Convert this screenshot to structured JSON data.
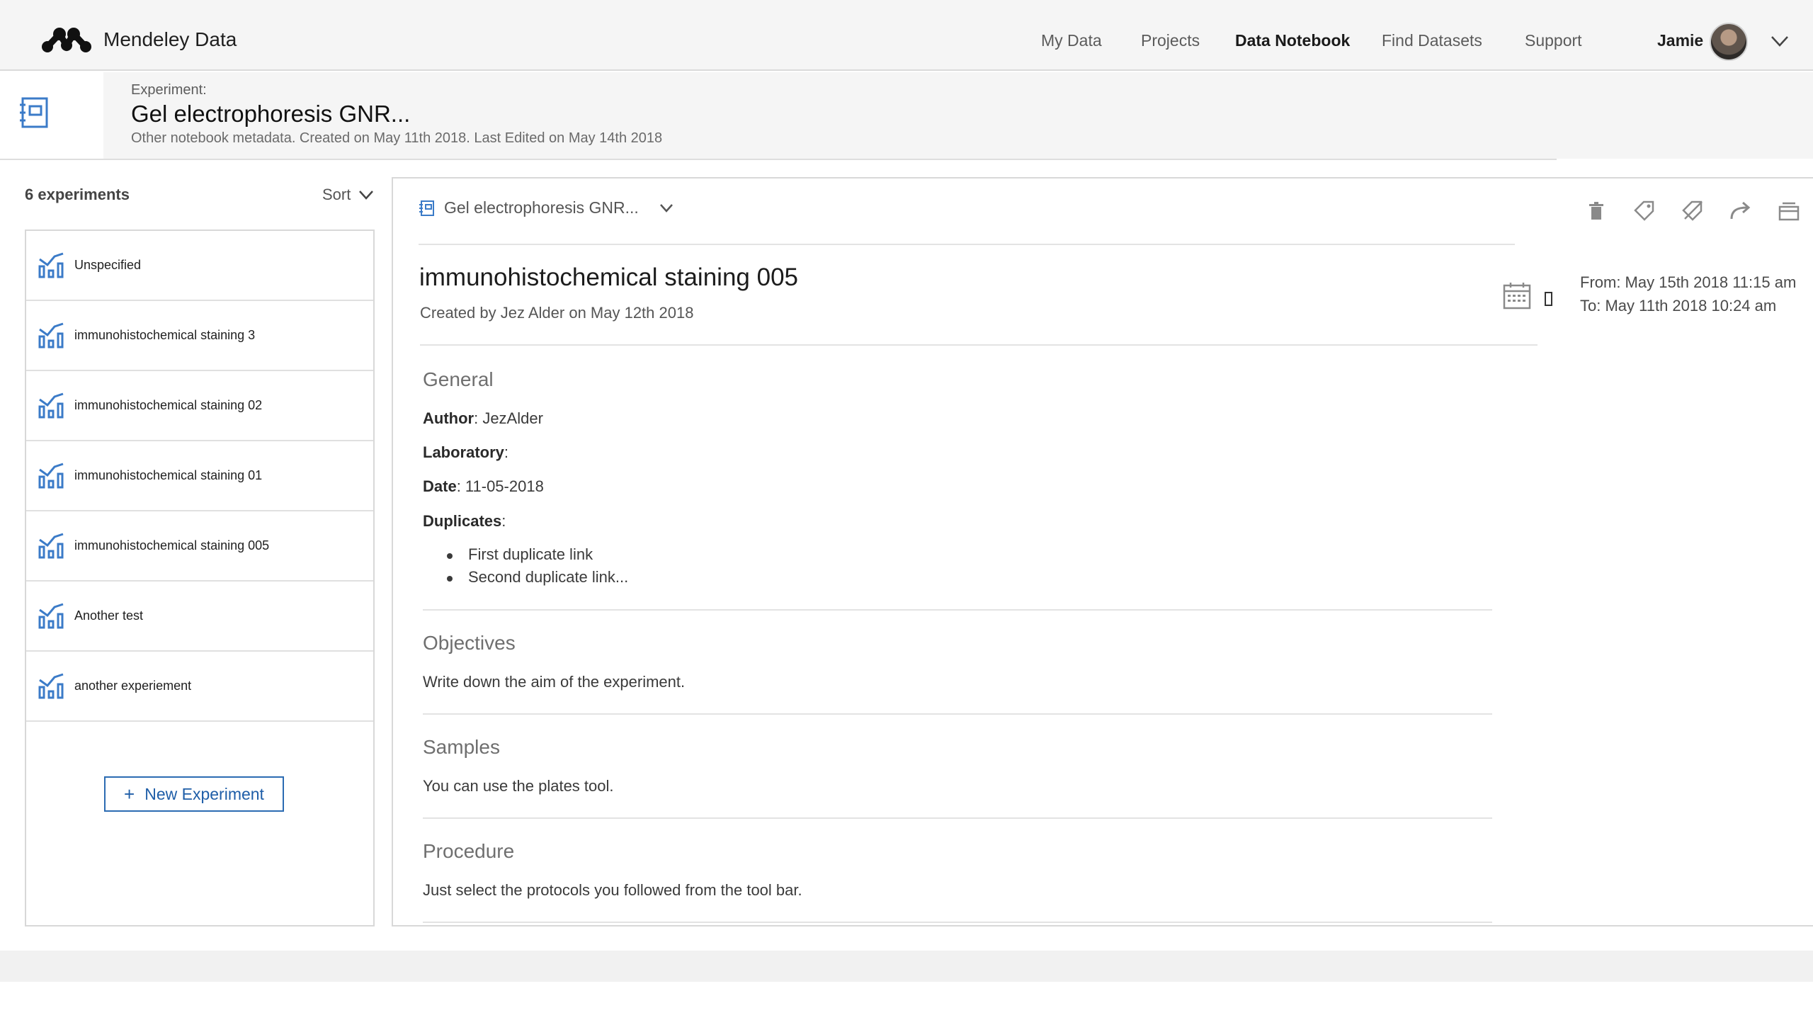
{
  "brand": {
    "name": "Mendeley Data"
  },
  "nav": {
    "items": [
      {
        "label": "My Data",
        "active": false
      },
      {
        "label": "Projects",
        "active": false
      },
      {
        "label": "Data Notebook",
        "active": true
      },
      {
        "label": "Find Datasets",
        "active": false
      },
      {
        "label": "Support",
        "active": false
      }
    ],
    "user_name": "Jamie"
  },
  "experiment_header": {
    "label": "Experiment:",
    "title": "Gel electrophoresis GNR...",
    "meta": "Other notebook metadata. Created on May 11th 2018. Last Edited on May 14th 2018"
  },
  "sidebar": {
    "count_label": "6 experiments",
    "sort_label": "Sort",
    "items": [
      {
        "label": "Unspecified"
      },
      {
        "label": "immunohistochemical staining 3"
      },
      {
        "label": "immunohistochemical staining 02"
      },
      {
        "label": "immunohistochemical staining 01"
      },
      {
        "label": "immunohistochemical staining 005"
      },
      {
        "label": "Another test"
      },
      {
        "label": "another experiement"
      }
    ],
    "new_button_label": "New Experiment"
  },
  "main": {
    "breadcrumb": "Gel electrophoresis GNR...",
    "entry_title": "immunohistochemical staining 005",
    "entry_subtitle": "Created by Jez Alder on May 12th 2018",
    "date_from": "From: May 15th 2018 11:15 am",
    "date_to": "To: May 11th 2018 10:24 am",
    "general": {
      "title": "General",
      "author_label": "Author",
      "author_value": ": JezAlder",
      "laboratory_label": "Laboratory",
      "laboratory_value": ":",
      "date_label": "Date",
      "date_value": ": 11-05-2018",
      "duplicates_label": "Duplicates",
      "duplicates_value": ":",
      "duplicates": [
        "First duplicate link",
        "Second duplicate link..."
      ]
    },
    "objectives": {
      "title": "Objectives",
      "text": "Write down the aim of the experiment."
    },
    "samples": {
      "title": "Samples",
      "text": "You can use the plates tool."
    },
    "procedure": {
      "title": "Procedure",
      "text": "Just select the protocols you followed from the tool bar."
    }
  },
  "colors": {
    "accent": "#2b6bb2",
    "icon_blue": "#3b7bc8",
    "background": "#f5f5f5"
  }
}
